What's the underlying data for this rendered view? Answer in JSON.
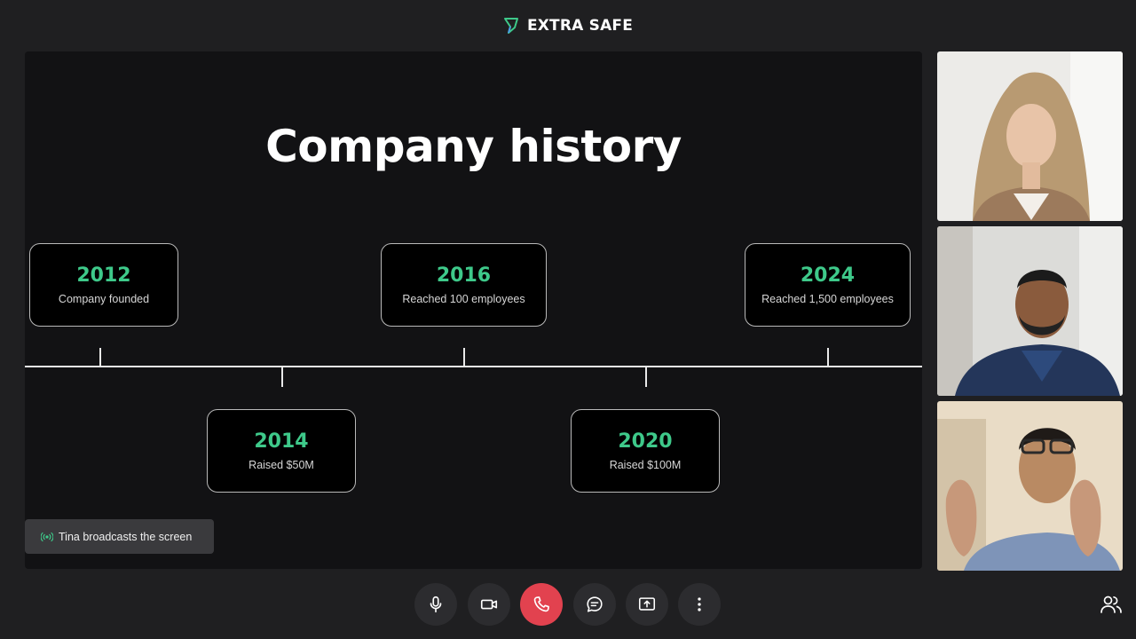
{
  "app": {
    "brand_name": "EXTRA SAFE",
    "brand_color": "#3ec98a"
  },
  "slide": {
    "title": "Company history",
    "milestones": [
      {
        "year": "2012",
        "label": "Company founded"
      },
      {
        "year": "2014",
        "label": "Raised $50M"
      },
      {
        "year": "2016",
        "label": "Reached 100 employees"
      },
      {
        "year": "2020",
        "label": "Raised $100M"
      },
      {
        "year": "2024",
        "label": "Reached 1,500 employees"
      }
    ]
  },
  "broadcast": {
    "text": "Tina broadcasts the screen"
  },
  "participants": [
    {
      "name": "participant-1"
    },
    {
      "name": "participant-2"
    },
    {
      "name": "participant-3"
    }
  ],
  "controls": [
    {
      "name": "microphone",
      "icon": "microphone-icon"
    },
    {
      "name": "camera",
      "icon": "video-camera-icon"
    },
    {
      "name": "end-call",
      "icon": "phone-icon",
      "color": "#e2424f"
    },
    {
      "name": "chat",
      "icon": "chat-bubble-icon"
    },
    {
      "name": "share-screen",
      "icon": "screen-share-icon"
    },
    {
      "name": "more-options",
      "icon": "more-vertical-icon"
    }
  ],
  "people_button": {
    "icon": "people-icon"
  }
}
